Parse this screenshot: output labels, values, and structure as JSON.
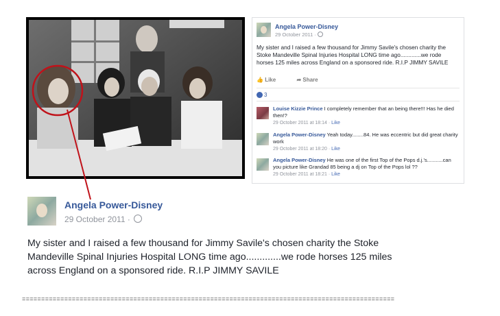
{
  "photo": {
    "description_icon": "photo-icon"
  },
  "screenshot_post": {
    "author": "Angela Power-Disney",
    "date": "29 October 2011 ·",
    "body": "My sister and I raised a few thousand for Jimmy Savile's chosen charity the Stoke Mandeville Spinal Injuries Hospital LONG time ago.............we rode horses 125 miles across England on a sponsored ride. R.I.P JIMMY SAVILE",
    "like_label": "Like",
    "share_label": "Share",
    "reaction_count": "3",
    "comments": [
      {
        "name": "Louise Kizzie Prince",
        "text": " I completely remember that an being there!!! Has he died then!?",
        "time": "29 October 2011 at 18:14 · ",
        "like": "Like"
      },
      {
        "name": "Angela Power-Disney",
        "text": " Yeah today........84. He was eccentric but did great charity work",
        "time": "29 October 2011 at 18:20 · ",
        "like": "Like"
      },
      {
        "name": "Angela Power-Disney",
        "text": " He was one of the first Top of the Pops d.j.'s...........can you picture like Grandad 85 being a dj on Top of the Pops lol ??",
        "time": "29 October 2011 at 18:21 · ",
        "like": "Like"
      }
    ]
  },
  "enlarged_post": {
    "author": "Angela Power-Disney",
    "date": "29 October 2011 ·",
    "body": "My sister and I raised a few thousand for Jimmy Savile's chosen charity the Stoke Mandeville Spinal Injuries Hospital LONG time ago.............we rode horses 125 miles across England on a sponsored ride. R.I.P JIMMY SAVILE"
  },
  "separator": "=================================================================================================",
  "colors": {
    "link": "#365899",
    "annotation": "#c0121a",
    "meta": "#90949c"
  }
}
